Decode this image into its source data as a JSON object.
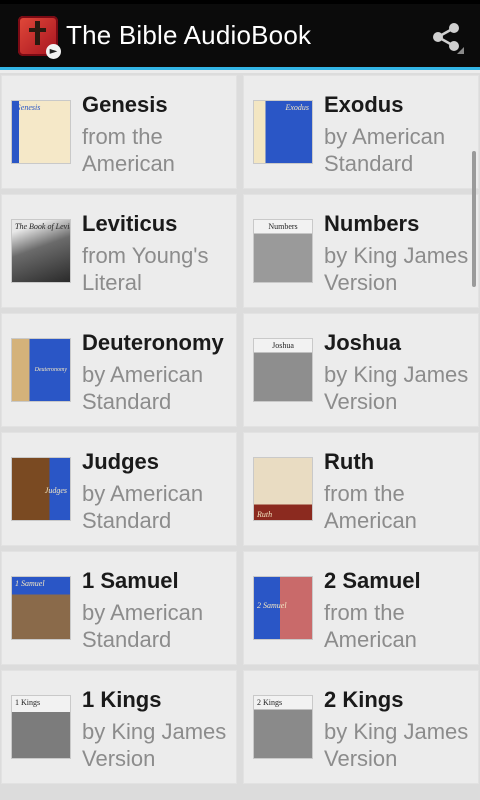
{
  "app": {
    "title": "The Bible AudioBook",
    "icon": "bible-audio-icon",
    "share_icon": "share-icon",
    "accent_color": "#33b5e5"
  },
  "books": [
    {
      "title": "Genesis",
      "subtitle": "from the American",
      "cover_text": "Genesis"
    },
    {
      "title": "Exodus",
      "subtitle": "by American Standard",
      "cover_text": "Exodus"
    },
    {
      "title": "Leviticus",
      "subtitle": "from Young's Literal",
      "cover_text": "The Book of Leviticus"
    },
    {
      "title": "Numbers",
      "subtitle": "by King James Version",
      "cover_text": "Numbers"
    },
    {
      "title": "Deuteronomy",
      "subtitle": "by American Standard",
      "cover_text": "Deuteronomy"
    },
    {
      "title": "Joshua",
      "subtitle": "by King James Version",
      "cover_text": "Joshua"
    },
    {
      "title": "Judges",
      "subtitle": "by American Standard",
      "cover_text": "Judges"
    },
    {
      "title": "Ruth",
      "subtitle": "from the American",
      "cover_text": "Ruth"
    },
    {
      "title": "1 Samuel",
      "subtitle": "by American Standard",
      "cover_text": "1 Samuel"
    },
    {
      "title": "2 Samuel",
      "subtitle": "from the American",
      "cover_text": "2 Samuel"
    },
    {
      "title": "1 Kings",
      "subtitle": "by King James Version",
      "cover_text": "1 Kings"
    },
    {
      "title": "2 Kings",
      "subtitle": "by King James Version",
      "cover_text": "2 Kings"
    }
  ]
}
